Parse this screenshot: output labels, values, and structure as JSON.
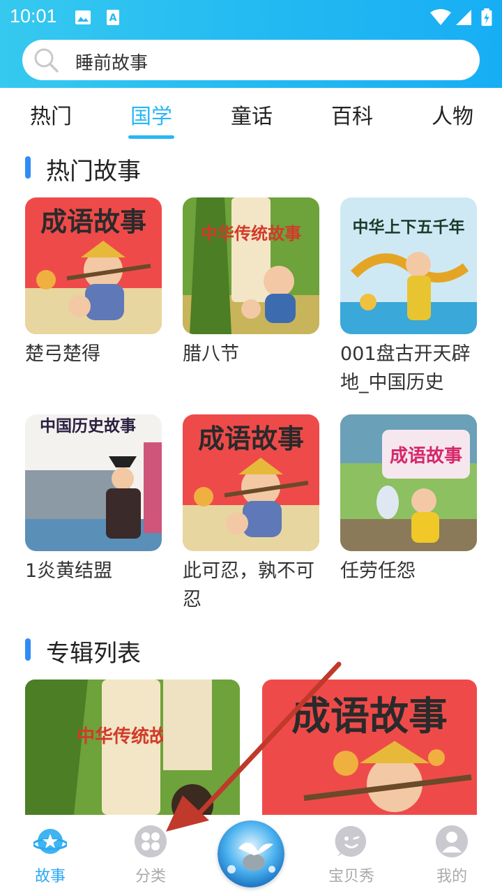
{
  "status": {
    "time": "10:01"
  },
  "search": {
    "placeholder": "睡前故事"
  },
  "tabs": [
    {
      "label": "热门"
    },
    {
      "label": "国学"
    },
    {
      "label": "童话"
    },
    {
      "label": "百科"
    },
    {
      "label": "人物"
    }
  ],
  "active_tab": "国学",
  "hot": {
    "title": "热门故事",
    "items": [
      {
        "title": "楚弓楚得",
        "cover_text": "成语故事"
      },
      {
        "title": "腊八节",
        "cover_text": "中华传统故事"
      },
      {
        "title": "001盘古开天辟地_中国历史",
        "cover_text": "中华上下五千年"
      },
      {
        "title": "1炎黄结盟",
        "cover_text": "中国历史故事"
      },
      {
        "title": "此可忍，孰不可忍",
        "cover_text": "成语故事"
      },
      {
        "title": "任劳任怨",
        "cover_text": "成语故事"
      }
    ]
  },
  "albums": {
    "title": "专辑列表",
    "items": [
      {
        "cover_text": "中华传统故事"
      },
      {
        "cover_text": "成语故事"
      }
    ]
  },
  "bottom_nav": [
    {
      "label": "故事",
      "icon": "planet-star-icon"
    },
    {
      "label": "分类",
      "icon": "grid-circles-icon"
    },
    {
      "label": "",
      "icon": "center-play-orb"
    },
    {
      "label": "宝贝秀",
      "icon": "wink-face-icon"
    },
    {
      "label": "我的",
      "icon": "person-icon"
    }
  ],
  "colors": {
    "accent": "#29b6f6",
    "section_bar": "#2f8cf4",
    "header_start": "#36c9ef",
    "header_end": "#18aef4",
    "arrow": "#c0392b"
  }
}
